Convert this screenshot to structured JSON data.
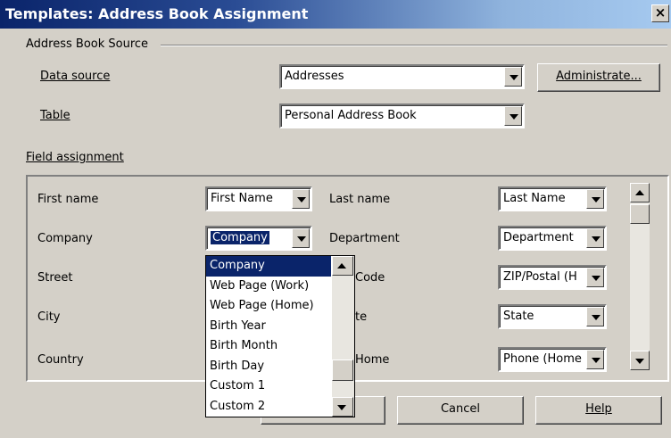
{
  "window": {
    "title": "Templates: Address Book Assignment",
    "close_glyph": "×"
  },
  "source_group": {
    "legend": "Address Book Source",
    "data_source_label": "Data source",
    "data_source_value": "Addresses",
    "table_label": "Table",
    "table_value": "Personal Address Book",
    "administrate_label": "Administrate..."
  },
  "field_group": {
    "legend": "Field assignment",
    "rows": [
      {
        "left_label": "First name",
        "left_value": "First Name",
        "right_label": "Last name",
        "right_value": "Last Name"
      },
      {
        "left_label": "Company",
        "left_value": "Company",
        "right_label": "Department",
        "right_value": "Department"
      },
      {
        "left_label": "Street",
        "left_value": "",
        "right_label": "Code",
        "right_value": "ZIP/Postal (H"
      },
      {
        "left_label": "City",
        "left_value": "",
        "right_label": "te",
        "right_value": "State"
      },
      {
        "left_label": "Country",
        "left_value": "",
        "right_label": "Home",
        "right_value": "Phone (Home"
      }
    ]
  },
  "dropdown_options": [
    "Company",
    "Web Page (Work)",
    "Web Page (Home)",
    "Birth Year",
    "Birth Month",
    "Birth Day",
    "Custom 1",
    "Custom 2"
  ],
  "buttons": {
    "cancel": "Cancel",
    "help": "Help"
  },
  "colors": {
    "title_start": "#0a246a",
    "title_end": "#a6caf0",
    "selection": "#0a246a",
    "face": "#d4d0c8"
  }
}
